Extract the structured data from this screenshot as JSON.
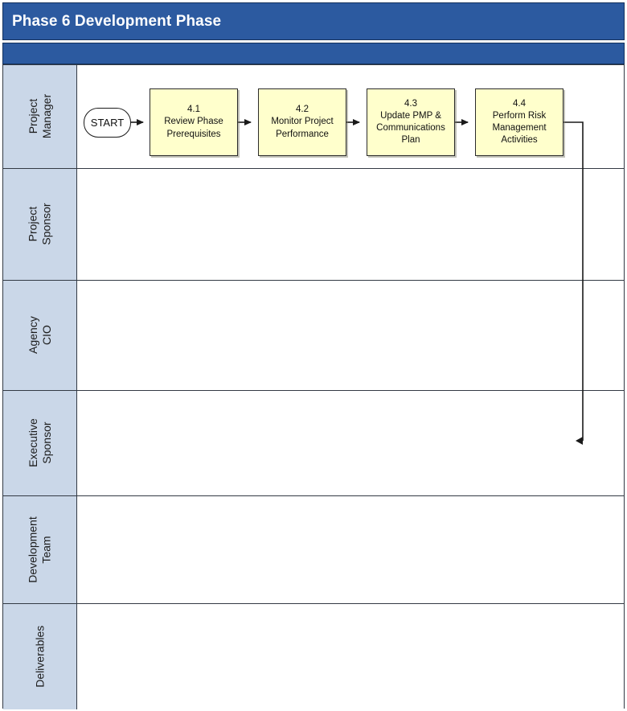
{
  "header": {
    "title": "Phase 6 Development Phase",
    "band_color": "#2C5AA0",
    "title_color": "#FFFFFF",
    "subtitle": ""
  },
  "colors": {
    "banner_blue": "#2C5AA0",
    "lane_header_fill": "#CAD7E8",
    "process_fill": "#FFFFCC",
    "line": "#333A44",
    "text": "#111111"
  },
  "lanes": [
    {
      "label_line1": "Project",
      "label_line2": "Manager",
      "name": "project-manager"
    },
    {
      "label_line1": "Project",
      "label_line2": "Sponsor",
      "name": "project-sponsor"
    },
    {
      "label_line1": "Agency",
      "label_line2": "CIO",
      "name": "agency-cio"
    },
    {
      "label_line1": "Executive",
      "label_line2": "Sponsor",
      "name": "executive-sponsor"
    },
    {
      "label_line1": "Development",
      "label_line2": "Team",
      "name": "development-team"
    },
    {
      "label_line1": "Deliverables",
      "label_line2": "",
      "name": "deliverables"
    }
  ],
  "flow": {
    "start": {
      "label": "START"
    },
    "steps": [
      {
        "number": "4.1",
        "line1": "Review Phase",
        "line2": "Prerequisites",
        "line3": ""
      },
      {
        "number": "4.2",
        "line1": "Monitor Project",
        "line2": "Performance",
        "line3": ""
      },
      {
        "number": "4.3",
        "line1": "Update PMP &",
        "line2": "Communications",
        "line3": "Plan"
      },
      {
        "number": "4.4",
        "line1": "Perform Risk",
        "line2": "Management",
        "line3": "Activities"
      }
    ]
  }
}
